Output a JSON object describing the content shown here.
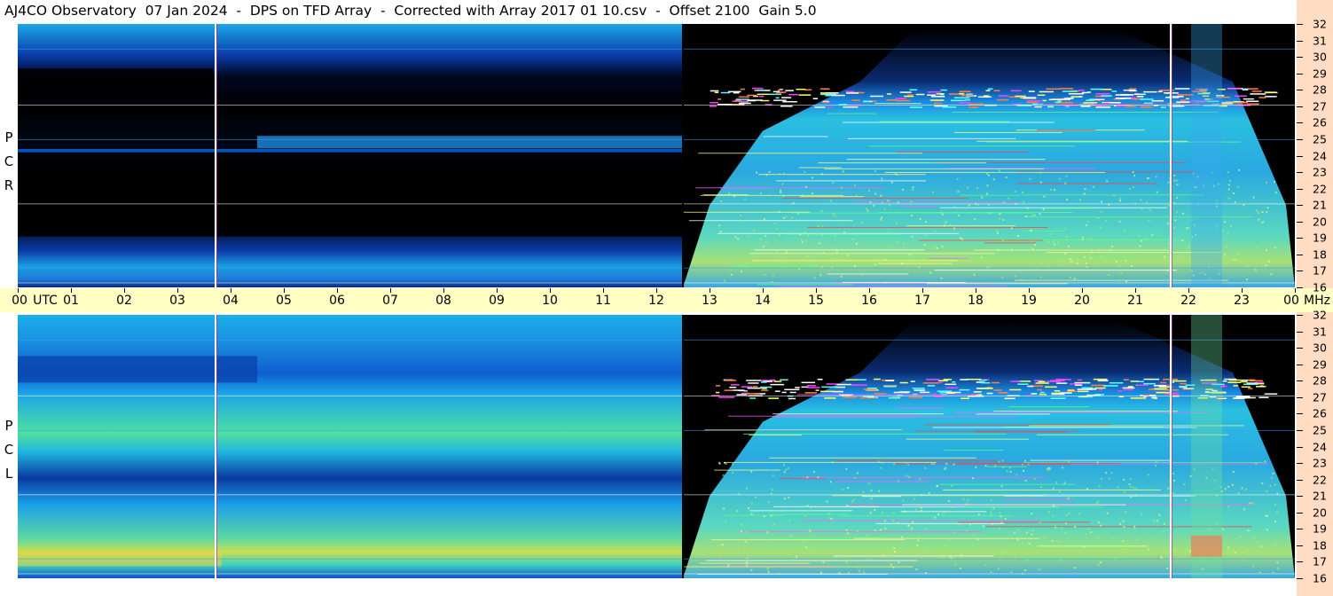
{
  "title": "AJ4CO Observatory  07 Jan 2024  -  DPS on TFD Array  -  Corrected with Array 2017 01 10.csv  -  Offset 2100  Gain 5.0",
  "panels": [
    {
      "name": "rcp",
      "label": [
        "R",
        "C",
        "P"
      ]
    },
    {
      "name": "lcp",
      "label": [
        "L",
        "C",
        "P"
      ]
    }
  ],
  "chart_data": {
    "type": "heatmap",
    "title": "AJ4CO Observatory  07 Jan 2024  -  DPS on TFD Array  -  Corrected with Array 2017 01 10.csv  -  Offset 2100  Gain 5.0",
    "xlabel": "UTC",
    "ylabel": "MHz",
    "x_ticks": [
      "00",
      "01",
      "02",
      "03",
      "04",
      "05",
      "06",
      "07",
      "08",
      "09",
      "10",
      "11",
      "12",
      "13",
      "14",
      "15",
      "16",
      "17",
      "18",
      "19",
      "20",
      "21",
      "22",
      "23",
      "00"
    ],
    "xlim_hours": [
      0,
      24
    ],
    "y_ticks": [
      32,
      31,
      30,
      29,
      28,
      27,
      26,
      25,
      24,
      23,
      22,
      21,
      20,
      19,
      18,
      17,
      16
    ],
    "ylim_mhz": [
      16,
      32
    ],
    "series": [
      "RCP",
      "LCP"
    ],
    "features": {
      "data_gap_start_hour": 12.5,
      "spike_hours": [
        3.7,
        21.65
      ]
    },
    "colors": {
      "low": "#000000",
      "mid": "#1e90ff",
      "high": "#ffff00",
      "peak": "#ff00ff"
    }
  }
}
